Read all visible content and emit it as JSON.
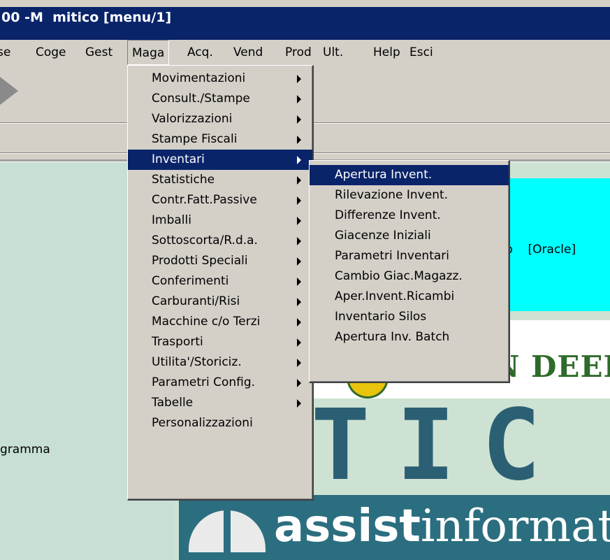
{
  "window": {
    "title": "00 -M  mitico [menu/1]"
  },
  "menubar": {
    "items": [
      "se",
      "Coge",
      "Gest",
      "Maga",
      "Acq.",
      "Vend",
      "Prod",
      "Ult.",
      "Help",
      "Esci"
    ],
    "open_item": "Maga"
  },
  "maga_menu": {
    "items": [
      {
        "label": "Movimentazioni",
        "submenu": true
      },
      {
        "label": "Consult./Stampe",
        "submenu": true
      },
      {
        "label": "Valorizzazioni",
        "submenu": true
      },
      {
        "label": "Stampe Fiscali",
        "submenu": true
      },
      {
        "label": "Inventari",
        "submenu": true,
        "selected": true
      },
      {
        "label": "Statistiche",
        "submenu": true
      },
      {
        "label": "Contr.Fatt.Passive",
        "submenu": true
      },
      {
        "label": "Imballi",
        "submenu": true
      },
      {
        "label": "Sottoscorta/R.d.a.",
        "submenu": true
      },
      {
        "label": "Prodotti Speciali",
        "submenu": true
      },
      {
        "label": "Conferimenti",
        "submenu": true
      },
      {
        "label": "Carburanti/Risi",
        "submenu": true
      },
      {
        "label": "Macchine c/o Terzi",
        "submenu": true
      },
      {
        "label": "Trasporti",
        "submenu": true
      },
      {
        "label": "Utilita'/Storiciz.",
        "submenu": true
      },
      {
        "label": "Parametri Config.",
        "submenu": true
      },
      {
        "label": "Tabelle",
        "submenu": true
      },
      {
        "label": "Personalizzazioni",
        "submenu": false
      }
    ]
  },
  "inventari_menu": {
    "items": [
      {
        "label": "Apertura Invent.",
        "selected": true
      },
      {
        "label": "Rilevazione Invent."
      },
      {
        "label": "Differenze Invent."
      },
      {
        "label": "Giacenze Iniziali"
      },
      {
        "label": "Parametri Inventari"
      },
      {
        "label": "Cambio Giac.Magazz."
      },
      {
        "label": "Aper.Invent.Ricambi"
      },
      {
        "label": "Inventario Silos"
      },
      {
        "label": "Apertura Inv. Batch"
      }
    ]
  },
  "left_panel": {
    "label": "gramma"
  },
  "info_panel": {
    "text": "gio    [Oracle]"
  },
  "branding": {
    "deere_text": "N DEEI",
    "big_text": "TIC",
    "assist_bold": "assist",
    "assist_light": "informati"
  },
  "colors": {
    "title_bg": "#0a246a",
    "menu_bg": "#d4d0c8",
    "selection": "#0a246a",
    "cyan_panel": "#00ffff",
    "deere_green": "#2f6a2b",
    "assist_teal": "#2b6e80"
  }
}
